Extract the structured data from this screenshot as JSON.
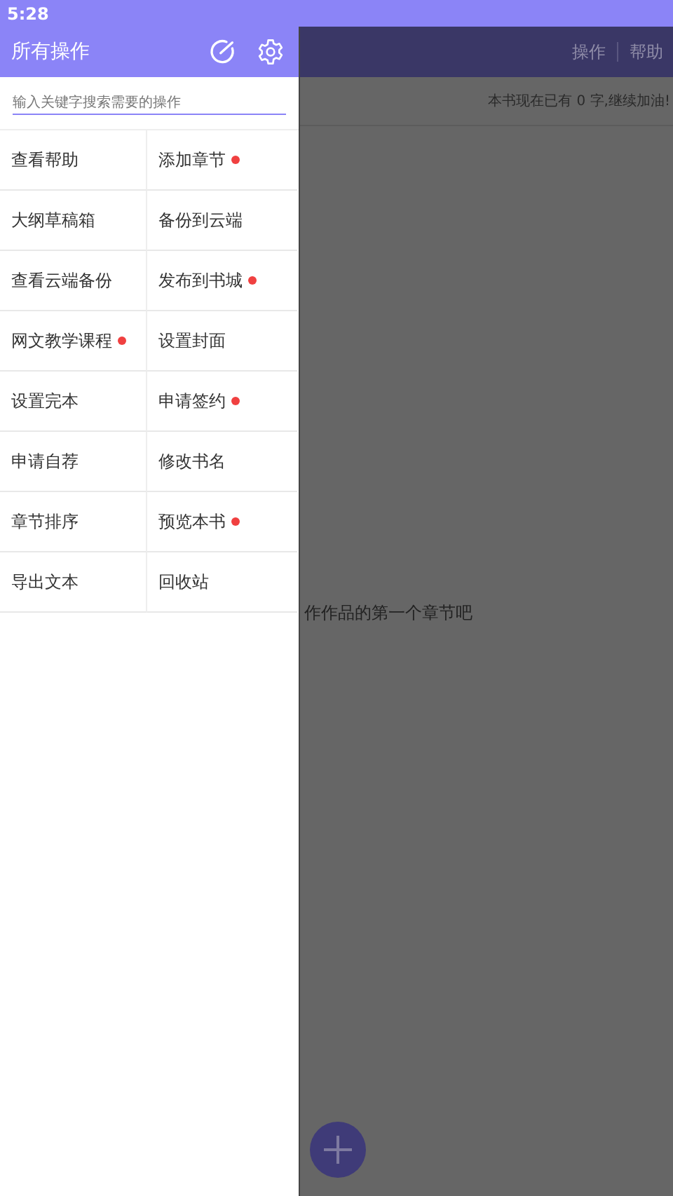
{
  "status_bar": {
    "time": "5:28"
  },
  "drawer": {
    "title": "所有操作",
    "search": {
      "placeholder": "输入关键字搜索需要的操作"
    },
    "actions": [
      {
        "label": "查看帮助",
        "badge": false
      },
      {
        "label": "添加章节",
        "badge": true
      },
      {
        "label": "大纲草稿箱",
        "badge": false
      },
      {
        "label": "备份到云端",
        "badge": false
      },
      {
        "label": "查看云端备份",
        "badge": false
      },
      {
        "label": "发布到书城",
        "badge": true
      },
      {
        "label": "网文教学课程",
        "badge": true
      },
      {
        "label": "设置封面",
        "badge": false
      },
      {
        "label": "设置完本",
        "badge": false
      },
      {
        "label": "申请签约",
        "badge": true
      },
      {
        "label": "申请自荐",
        "badge": false
      },
      {
        "label": "修改书名",
        "badge": false
      },
      {
        "label": "章节排序",
        "badge": false
      },
      {
        "label": "预览本书",
        "badge": true
      },
      {
        "label": "导出文本",
        "badge": false
      },
      {
        "label": "回收站",
        "badge": false
      }
    ]
  },
  "background": {
    "toolbar_actions": [
      "操作",
      "帮助"
    ],
    "word_count": "本书现在已有 0 字,继续加油!",
    "empty_hint": "作作品的第一个章节吧"
  }
}
